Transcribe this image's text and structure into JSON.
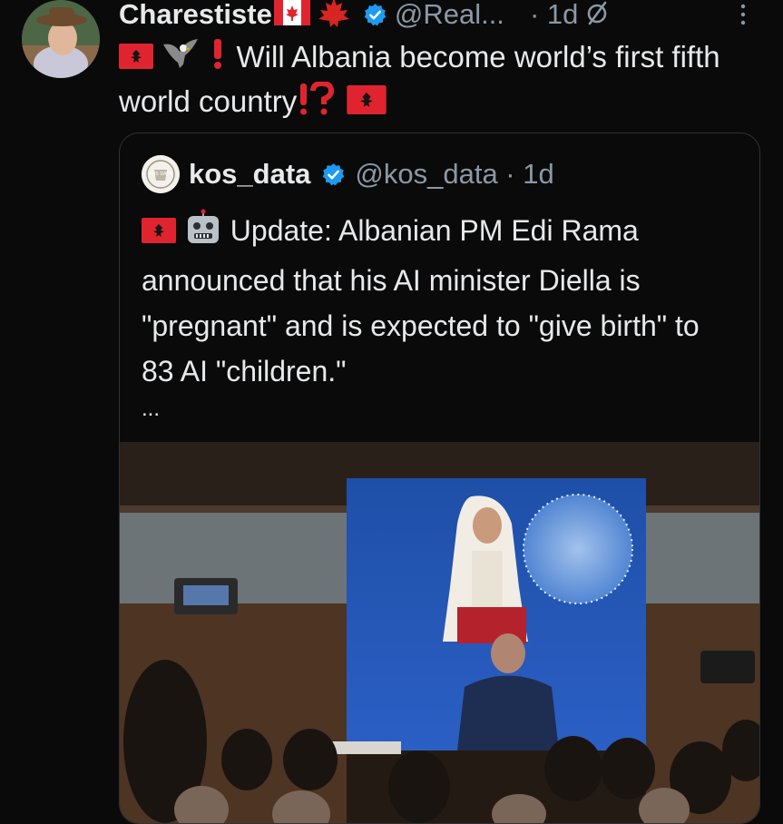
{
  "tweet": {
    "author_name": "Charestiste",
    "handle": "@Real...",
    "time": "· 1d",
    "text": "Will Albania become world’s first fifth world country"
  },
  "quote": {
    "author_name": "kos_data",
    "handle": "@kos_data · 1d",
    "text": "Update: Albanian PM Edi Rama announced that his AI minister Diella is \"pregnant\" and is expected to \"give birth\" to 83 AI \"children.\"",
    "ellipsis": "...",
    "avatar_label": "KOS DATA"
  },
  "icons": {
    "verified": "verified-badge-icon",
    "grok": "slashed-circle-icon",
    "more": "more-vertical-icon",
    "flag_canada": "canada-flag-icon",
    "maple": "maple-leaf-icon",
    "flag_albania": "albania-flag-icon",
    "eagle": "eagle-icon",
    "exclamation": "red-exclamation-icon",
    "interrobang": "red-interrobang-icon",
    "robot": "robot-icon"
  },
  "colors": {
    "background": "#0a0a0b",
    "text": "#e7e9ea",
    "muted": "#8b98a5",
    "verified": "#1d9bf0",
    "red": "#e0242f",
    "border": "#2f3336"
  }
}
